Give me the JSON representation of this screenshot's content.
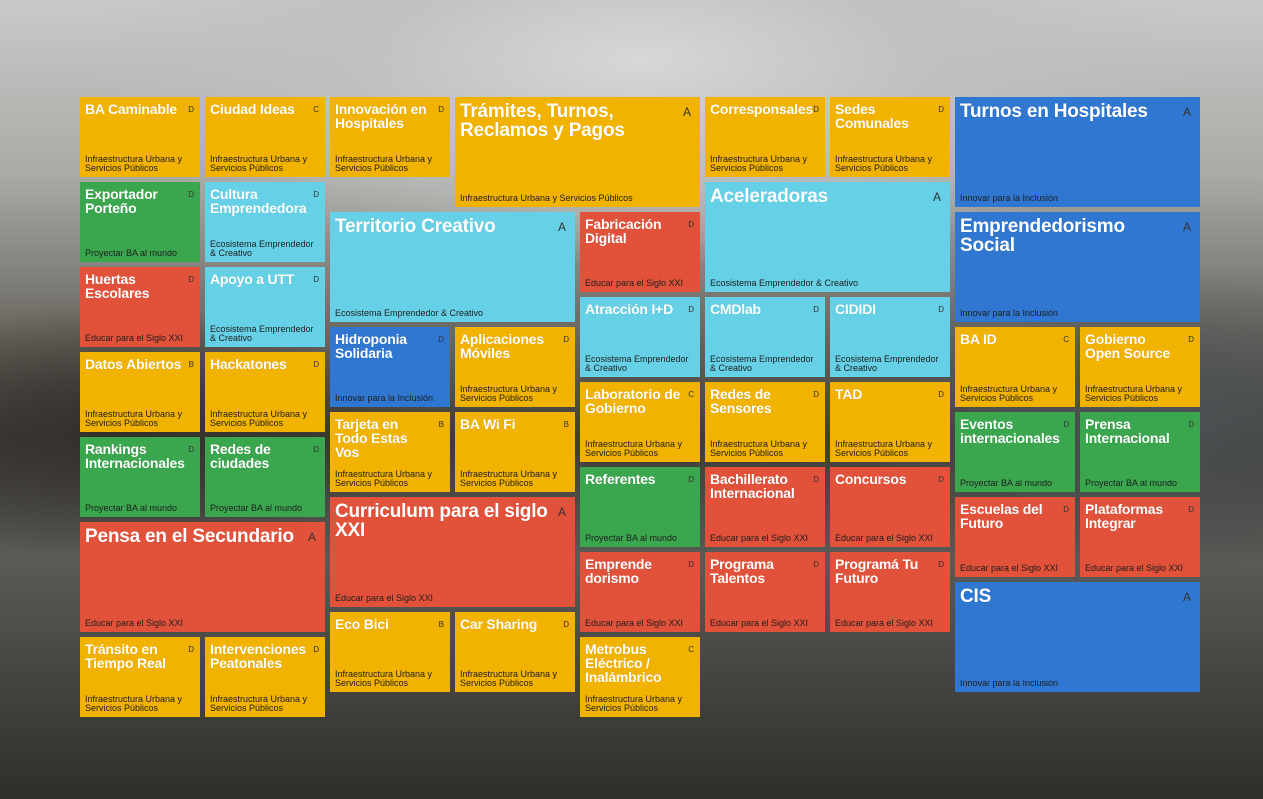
{
  "colors": {
    "yellow": "#f2b200",
    "blue": "#2f77d0",
    "cyan": "#66d1e6",
    "green": "#3aa64e",
    "red": "#e2523a"
  },
  "categories": {
    "infra": "Infraestructura Urbana y Servicios Públicos",
    "eco": "Ecosistema Emprendedor & Creativo",
    "innovar": "Innovar para la Inclusión",
    "proyectar": "Proyectar BA al mundo",
    "educar": "Educar para el Siglo XXI"
  },
  "tiles": [
    {
      "title": "BA Caminable",
      "grade": "D",
      "category": "Infraestructura Urbana y Servicios Públicos",
      "color": "yellow"
    },
    {
      "title": "Ciudad Ideas",
      "grade": "C",
      "category": "Infraestructura Urbana y Servicios Públicos",
      "color": "yellow"
    },
    {
      "title": "Innovación en Hospitales",
      "grade": "D",
      "category": "Infraestructura Urbana y Servicios Públicos",
      "color": "yellow"
    },
    {
      "title": "Trámites, Turnos, Reclamos y Pagos",
      "grade": "A",
      "category": "Infraestructura Urbana y Servicios Públicos",
      "color": "yellow"
    },
    {
      "title": "Corresponsales",
      "grade": "D",
      "category": "Infraestructura Urbana y Servicios Públicos",
      "color": "yellow"
    },
    {
      "title": "Sedes Comunales",
      "grade": "D",
      "category": "Infraestructura Urbana y Servicios Públicos",
      "color": "yellow"
    },
    {
      "title": "Turnos en Hospitales",
      "grade": "A",
      "category": "Innovar para la Inclusión",
      "color": "blue"
    },
    {
      "title": "Exportador Porteño",
      "grade": "D",
      "category": "Proyectar BA al mundo",
      "color": "green"
    },
    {
      "title": "Cultura Emprendedora",
      "grade": "D",
      "category": "Ecosistema Emprendedor & Creativo",
      "color": "cyan"
    },
    {
      "title": "Territorio Creativo",
      "grade": "A",
      "category": "Ecosistema Emprendedor & Creativo",
      "color": "cyan"
    },
    {
      "title": "Fabricación Digital",
      "grade": "D",
      "category": "Educar para el Siglo XXI",
      "color": "red"
    },
    {
      "title": "Aceleradoras",
      "grade": "A",
      "category": "Ecosistema Emprendedor & Creativo",
      "color": "cyan"
    },
    {
      "title": "Emprendedorismo Social",
      "grade": "A",
      "category": "Innovar para la Inclusión",
      "color": "blue"
    },
    {
      "title": "Huertas Escolares",
      "grade": "D",
      "category": "Educar para el Siglo XXI",
      "color": "red"
    },
    {
      "title": "Apoyo a UTT",
      "grade": "D",
      "category": "Ecosistema Emprendedor & Creativo",
      "color": "cyan"
    },
    {
      "title": "Hidroponia Solidaria",
      "grade": "D",
      "category": "Innovar para la Inclusión",
      "color": "blue"
    },
    {
      "title": "Aplicaciones Móviles",
      "grade": "D",
      "category": "Infraestructura Urbana y Servicios Públicos",
      "color": "yellow"
    },
    {
      "title": "Atracción I+D",
      "grade": "D",
      "category": "Ecosistema Emprendedor & Creativo",
      "color": "cyan"
    },
    {
      "title": "CMDlab",
      "grade": "D",
      "category": "Ecosistema Emprendedor & Creativo",
      "color": "cyan"
    },
    {
      "title": "CIDIDI",
      "grade": "D",
      "category": "Ecosistema Emprendedor & Creativo",
      "color": "cyan"
    },
    {
      "title": "BA ID",
      "grade": "C",
      "category": "Infraestructura Urbana y Servicios Públicos",
      "color": "yellow"
    },
    {
      "title": "Gobierno Open Source",
      "grade": "D",
      "category": "Infraestructura Urbana y Servicios Públicos",
      "color": "yellow"
    },
    {
      "title": "Datos Abiertos",
      "grade": "B",
      "category": "Infraestructura Urbana y Servicios Públicos",
      "color": "yellow"
    },
    {
      "title": "Hackatones",
      "grade": "D",
      "category": "Infraestructura Urbana y Servicios Públicos",
      "color": "yellow"
    },
    {
      "title": "Tarjeta en Todo Estas Vos",
      "grade": "B",
      "category": "Infraestructura Urbana y Servicios Públicos",
      "color": "yellow"
    },
    {
      "title": "BA Wi Fi",
      "grade": "B",
      "category": "Infraestructura Urbana y Servicios Públicos",
      "color": "yellow"
    },
    {
      "title": "Laboratorio de Gobierno",
      "grade": "C",
      "category": "Infraestructura Urbana y Servicios Públicos",
      "color": "yellow"
    },
    {
      "title": "Redes de Sensores",
      "grade": "D",
      "category": "Infraestructura Urbana y Servicios Públicos",
      "color": "yellow"
    },
    {
      "title": "TAD",
      "grade": "D",
      "category": "Infraestructura Urbana y Servicios Públicos",
      "color": "yellow"
    },
    {
      "title": "Eventos internacionales",
      "grade": "D",
      "category": "Proyectar BA al mundo",
      "color": "green"
    },
    {
      "title": "Prensa Internacional",
      "grade": "D",
      "category": "Proyectar BA al mundo",
      "color": "green"
    },
    {
      "title": "Rankings Internacionales",
      "grade": "D",
      "category": "Proyectar BA al mundo",
      "color": "green"
    },
    {
      "title": "Redes de ciudades",
      "grade": "D",
      "category": "Proyectar BA al mundo",
      "color": "green"
    },
    {
      "title": "Curriculum para el siglo XXI",
      "grade": "A",
      "category": "Educar para el Siglo XXI",
      "color": "red"
    },
    {
      "title": "Referentes",
      "grade": "D",
      "category": "Proyectar BA al mundo",
      "color": "green"
    },
    {
      "title": "Bachillerato Internacional",
      "grade": "D",
      "category": "Educar para el Siglo XXI",
      "color": "red"
    },
    {
      "title": "Concursos",
      "grade": "D",
      "category": "Educar para el Siglo XXI",
      "color": "red"
    },
    {
      "title": "Escuelas del Futuro",
      "grade": "D",
      "category": "Educar para el Siglo XXI",
      "color": "red"
    },
    {
      "title": "Plataformas Integrar",
      "grade": "D",
      "category": "Educar para el Siglo XXI",
      "color": "red"
    },
    {
      "title": "Pensa en el Secundario",
      "grade": "A",
      "category": "Educar para el Siglo XXI",
      "color": "red"
    },
    {
      "title": "Emprende dorismo",
      "grade": "D",
      "category": "Educar para el Siglo XXI",
      "color": "red"
    },
    {
      "title": "Programa Talentos",
      "grade": "D",
      "category": "Educar para el Siglo XXI",
      "color": "red"
    },
    {
      "title": "Programá Tu Futuro",
      "grade": "D",
      "category": "Educar para el Siglo XXI",
      "color": "red"
    },
    {
      "title": "CIS",
      "grade": "A",
      "category": "Innovar para la Inclusión",
      "color": "blue"
    },
    {
      "title": "Eco Bici",
      "grade": "B",
      "category": "Infraestructura Urbana y Servicios Públicos",
      "color": "yellow"
    },
    {
      "title": "Car Sharing",
      "grade": "D",
      "category": "Infraestructura Urbana y Servicios Públicos",
      "color": "yellow"
    },
    {
      "title": "Tránsito en Tiempo Real",
      "grade": "D",
      "category": "Infraestructura Urbana y Servicios Públicos",
      "color": "yellow"
    },
    {
      "title": "Intervenciones Peatonales",
      "grade": "D",
      "category": "Infraestructura Urbana y Servicios Públicos",
      "color": "yellow"
    },
    {
      "title": "Metrobus Eléctrico / Inalámbrico",
      "grade": "C",
      "category": "Infraestructura Urbana y Servicios Públicos",
      "color": "yellow"
    }
  ]
}
